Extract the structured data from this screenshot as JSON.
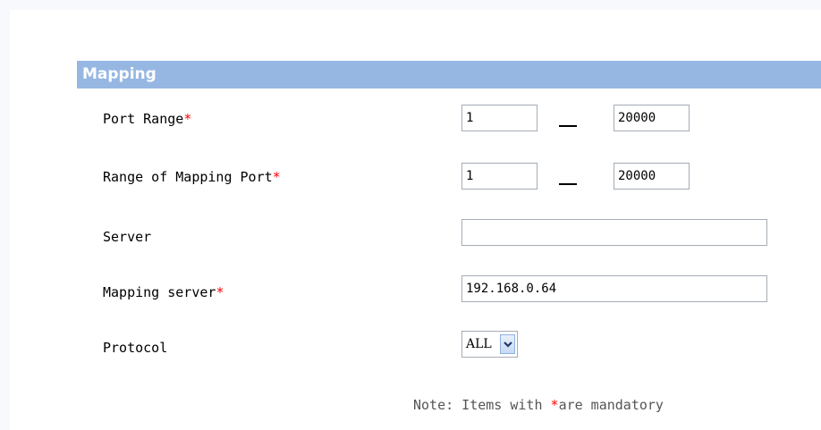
{
  "section": {
    "title": "Mapping"
  },
  "fields": {
    "port_range": {
      "label": "Port Range",
      "required_mark": "*",
      "from": "1",
      "separator": "—",
      "to": "20000"
    },
    "mapping_port_range": {
      "label": "Range of Mapping Port",
      "required_mark": "*",
      "from": "1",
      "separator": "—",
      "to": "20000"
    },
    "server": {
      "label": "Server",
      "value": ""
    },
    "mapping_server": {
      "label": "Mapping server",
      "required_mark": "*",
      "value": "192.168.0.64"
    },
    "protocol": {
      "label": "Protocol",
      "selected": "ALL",
      "dropdown_icon": "chevron-down-icon"
    }
  },
  "note": {
    "prefix": "Note: Items with ",
    "mark": "*",
    "suffix": "are mandatory"
  },
  "colors": {
    "header_bg": "#97b7e3",
    "header_text": "#ffffff",
    "required": "#ff0000",
    "page_bg": "#f7f9fc",
    "input_border": "#a5acb5"
  }
}
